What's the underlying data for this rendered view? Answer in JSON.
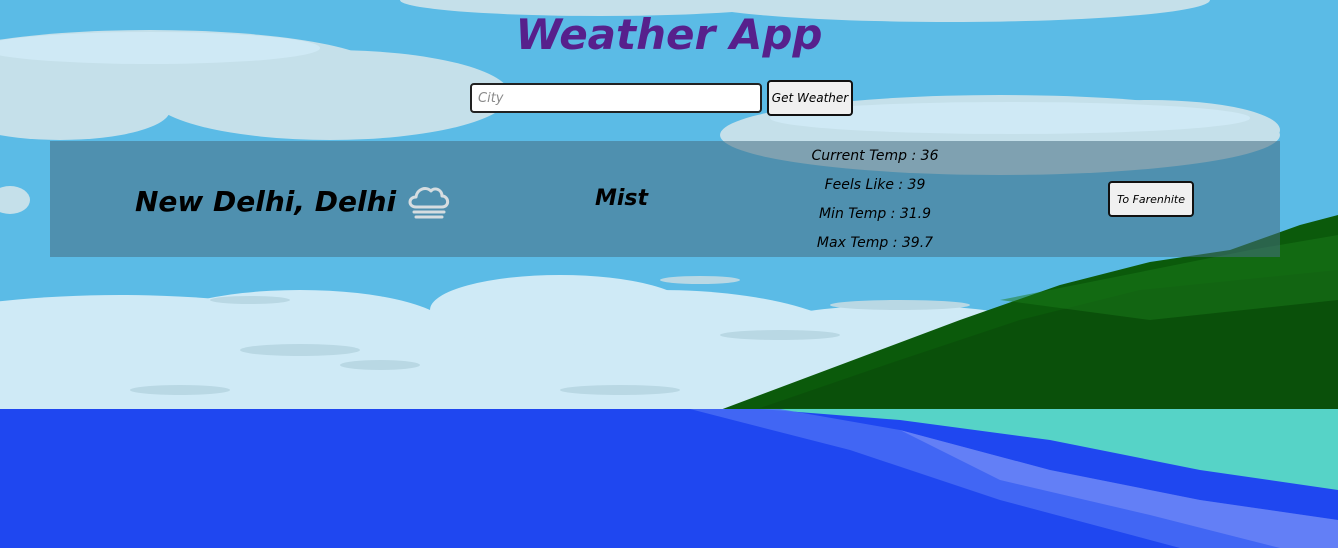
{
  "app": {
    "title": "Weather App"
  },
  "search": {
    "placeholder": "City",
    "value": "",
    "button_label": "Get Weather"
  },
  "weather": {
    "location": "New Delhi, Delhi",
    "icon": "cloud-icon",
    "condition": "Mist",
    "current_temp": "Current Temp : 36",
    "feels_like": "Feels Like : 39",
    "min_temp": "Min Temp : 31.9",
    "max_temp": "Max Temp : 39.7",
    "convert_label": "To Farenhite"
  },
  "colors": {
    "title": "#57208c",
    "sky": "#5bbbe6",
    "sea": "#1f47f0",
    "lagoon": "#56d3c7",
    "forest": "#0b5a0b"
  }
}
